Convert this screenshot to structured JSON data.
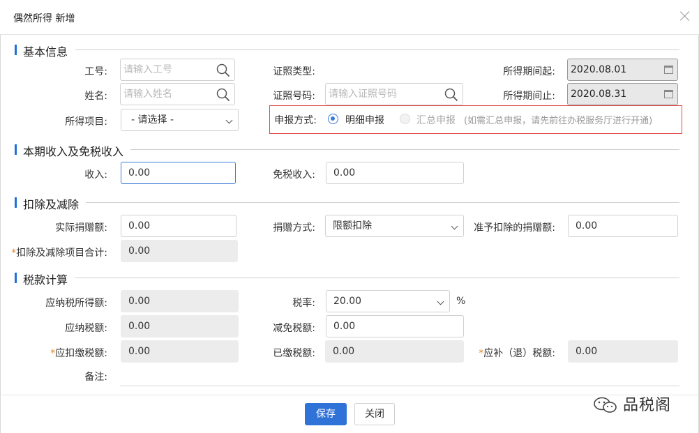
{
  "dialog": {
    "title": "偶然所得 新增"
  },
  "sections": {
    "basic": "基本信息",
    "income": "本期收入及免税收入",
    "deduction": "扣除及减除",
    "tax": "税款计算"
  },
  "basic": {
    "emp_id_label": "工号:",
    "emp_id_placeholder": "请输入工号",
    "name_label": "姓名:",
    "name_placeholder": "请输入姓名",
    "income_item_label": "所得项目:",
    "income_item_value": "- 请选择 -",
    "id_type_label": "证照类型:",
    "id_no_label": "证照号码:",
    "id_no_placeholder": "请输入证照号码",
    "period_start_label": "所得期间起:",
    "period_start_value": "2020.08.01",
    "period_end_label": "所得期间止:",
    "period_end_value": "2020.08.31",
    "declare_method_label": "申报方式:",
    "declare_detail": "明细申报",
    "declare_summary": "汇总申报",
    "declare_note": "(如需汇总申报，请先前往办税服务厅进行开通)"
  },
  "income": {
    "income_label": "收入:",
    "income_value": "0.00",
    "exempt_label": "免税收入:",
    "exempt_value": "0.00"
  },
  "deduction": {
    "donation_label": "实际捐赠额:",
    "donation_value": "0.00",
    "donation_method_label": "捐赠方式:",
    "donation_method_value": "限额扣除",
    "allowed_label": "准予扣除的捐赠额:",
    "allowed_value": "0.00",
    "total_req": "*",
    "total_label": "扣除及减除项目合计:",
    "total_value": "0.00"
  },
  "tax": {
    "taxable_income_label": "应纳税所得额:",
    "taxable_income_value": "0.00",
    "rate_label": "税率:",
    "rate_value": "20.00",
    "rate_unit": "%",
    "tax_payable_label": "应纳税额:",
    "tax_payable_value": "0.00",
    "tax_relief_label": "减免税额:",
    "tax_relief_value": "0.00",
    "withhold_req": "*",
    "withhold_label": "应扣缴税额:",
    "withhold_value": "0.00",
    "paid_label": "已缴税额:",
    "paid_value": "0.00",
    "refund_req": "*",
    "refund_label": "应补（退）税额:",
    "refund_value": "0.00",
    "remark_label": "备注:"
  },
  "footer": {
    "save": "保存",
    "close": "关闭"
  },
  "watermark": {
    "text": "品税阁",
    "icon": "wechat-icon"
  },
  "colors": {
    "accent": "#2f72d8",
    "section_bar": "#1e6fd9",
    "highlight_box": "#e24a4a",
    "required": "#e08a2b"
  }
}
